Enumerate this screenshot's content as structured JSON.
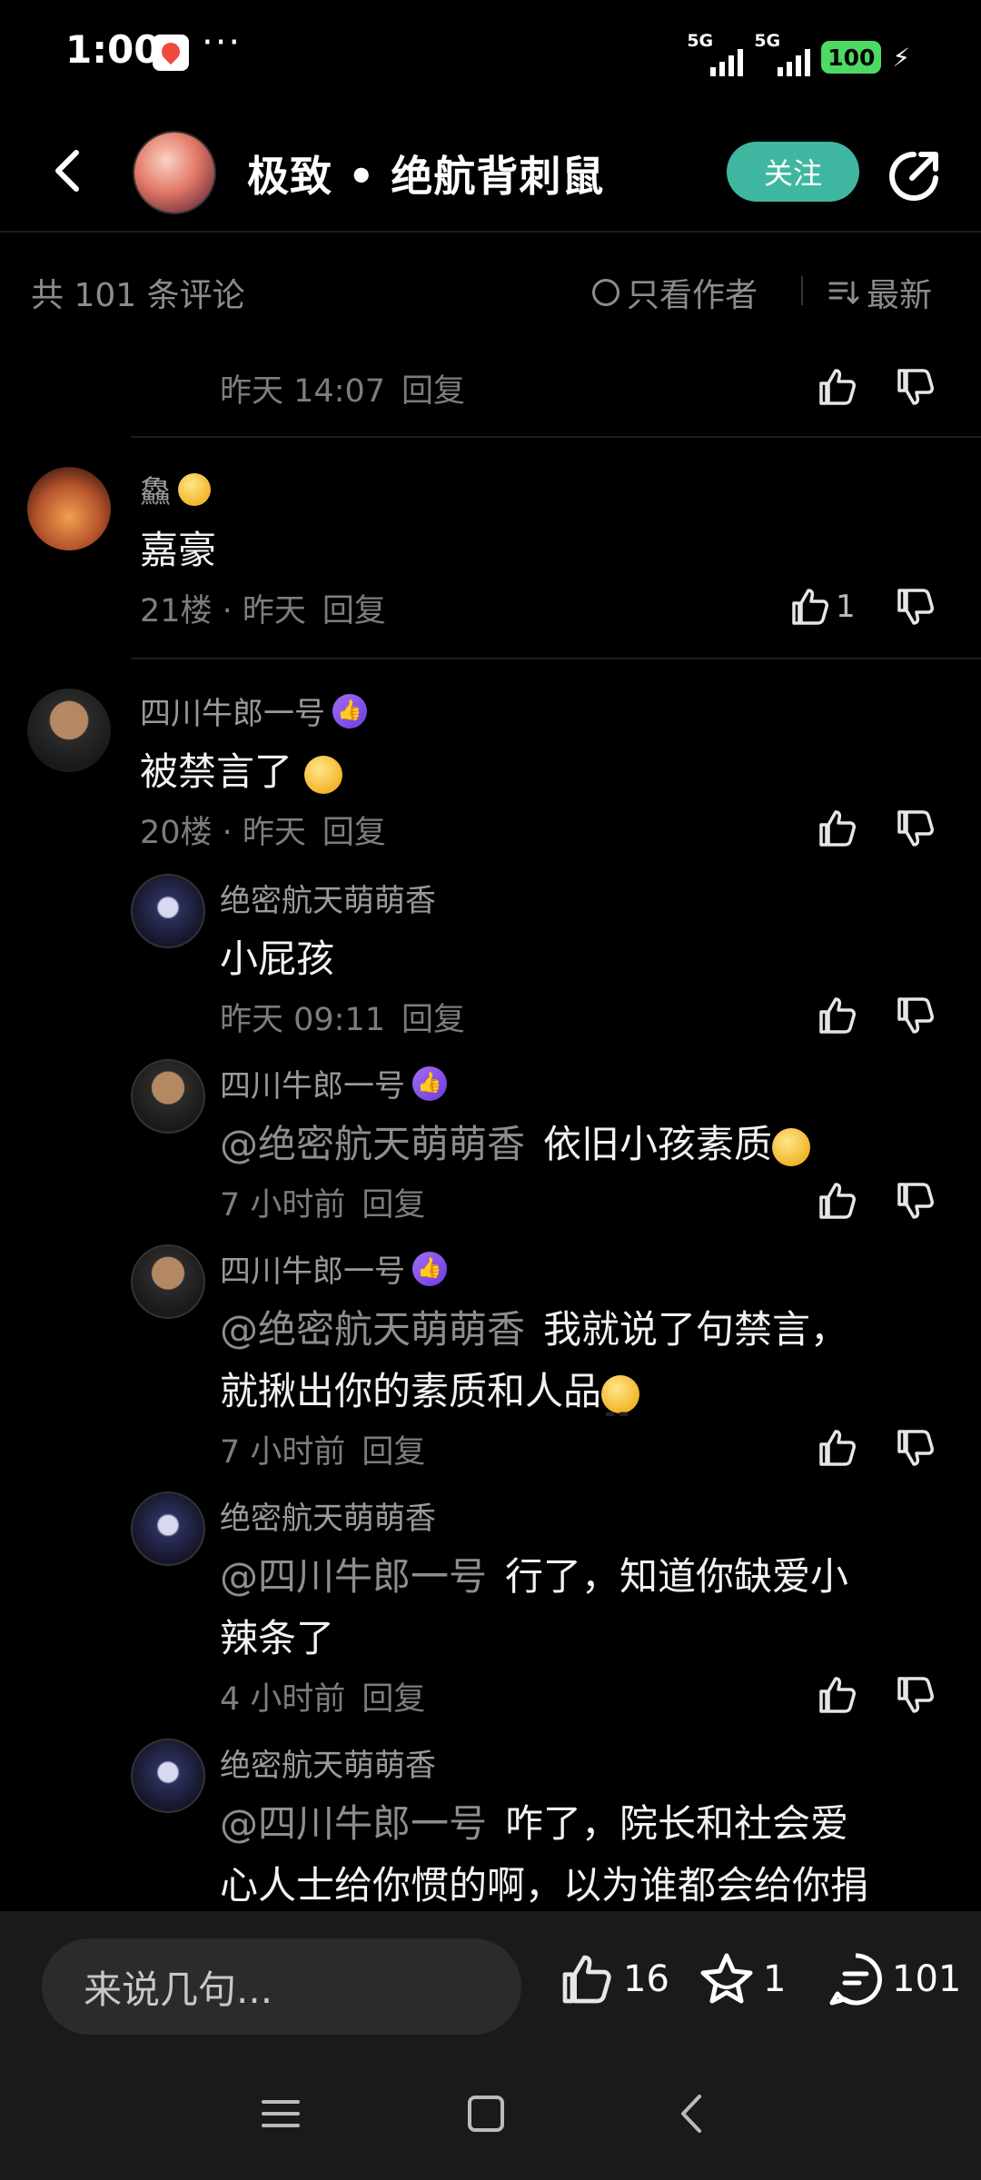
{
  "status_bar": {
    "time": "1:00",
    "dots": "···",
    "network_1": "5G",
    "network_2": "5G",
    "battery": "100"
  },
  "header": {
    "title": "极致 • 绝航背刺鼠",
    "follow_label": "关注"
  },
  "sort_bar": {
    "total": "共 101 条评论",
    "author_only": "只看作者",
    "sort_latest": "最新"
  },
  "comments": {
    "prev_tail": {
      "time": "昨天 14:07",
      "reply": "回复"
    },
    "c21": {
      "user": "鱻",
      "text": "嘉豪",
      "floor": "21楼 · 昨天",
      "reply": "回复",
      "likes": "1"
    },
    "c20": {
      "user": "四川牛郎一号",
      "text": "被禁言了",
      "floor": "20楼 · 昨天",
      "reply": "回复"
    },
    "r1": {
      "user": "绝密航天萌萌香",
      "text": "小屁孩",
      "time": "昨天 09:11",
      "reply": "回复"
    },
    "r2": {
      "user": "四川牛郎一号",
      "mention": "@绝密航天萌萌香",
      "text": "依旧小孩素质",
      "time": "7 小时前",
      "reply": "回复"
    },
    "r3": {
      "user": "四川牛郎一号",
      "mention": "@绝密航天萌萌香",
      "text_line1": "我就说了句禁言，",
      "text_line2": "就揪出你的素质和人品",
      "time": "7 小时前",
      "reply": "回复"
    },
    "r4": {
      "user": "绝密航天萌萌香",
      "mention": "@四川牛郎一号",
      "text_line1": "行了，知道你缺爱小",
      "text_line2": "辣条了",
      "time": "4 小时前",
      "reply": "回复"
    },
    "r5": {
      "user": "绝密航天萌萌香",
      "mention": "@四川牛郎一号",
      "text_line1": "咋了，院长和社会爱",
      "text_line2": "心人士给你惯的啊，以为谁都会给你捐"
    }
  },
  "bottom_bar": {
    "input_placeholder": "来说几句...",
    "likes": "16",
    "favorites": "1",
    "comments": "101"
  },
  "icons": {
    "back": "back-arrow-icon",
    "share": "share-icon",
    "like": "thumb-up-icon",
    "dislike": "thumb-down-icon",
    "favorite": "star-icon",
    "comment": "comment-bubble-icon"
  },
  "colors": {
    "accent": "#3fb7a0",
    "badge": "#8a55ee",
    "battery": "#4cd964"
  }
}
